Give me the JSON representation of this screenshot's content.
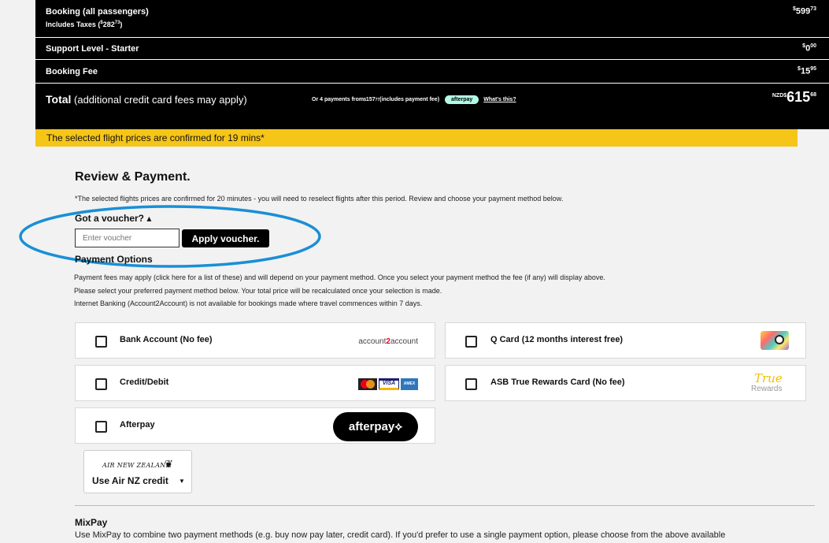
{
  "summary": {
    "booking_label": "Booking (all passengers)",
    "booking_taxes_prefix": "Includes Taxes (",
    "booking_taxes_currency": "$",
    "booking_taxes_whole": "282",
    "booking_taxes_cents": "73",
    "booking_taxes_suffix": ")",
    "booking_price_currency": "$",
    "booking_price_whole": "599",
    "booking_price_cents": "73",
    "support_label": "Support Level - Starter",
    "support_price_currency": "$",
    "support_price_whole": "0",
    "support_price_cents": "00",
    "fee_label": "Booking Fee",
    "fee_price_currency": "$",
    "fee_price_whole": "15",
    "fee_price_cents": "95",
    "total_bold": "Total",
    "total_note": " (additional credit card fees may apply)",
    "installments_prefix": "Or 4 payments from ",
    "installments_currency": "$",
    "installments_whole": "157",
    "installments_cents": "77",
    "installments_suffix": " (includes payment fee)",
    "afterpay_pill": "afterpay",
    "whats_this": "What's this?",
    "total_currency": "NZD$",
    "total_whole": "615",
    "total_cents": "68"
  },
  "banner": {
    "text": "The selected flight prices are confirmed for 19 mins*"
  },
  "review": {
    "title": "Review & Payment.",
    "note": "*The selected flights prices are confirmed for 20 minutes - you will need to reselect flights after this period. Review and choose your payment method below.",
    "voucher_toggle": "Got a voucher? ▴",
    "voucher_placeholder": "Enter voucher",
    "voucher_button": "Apply voucher.",
    "payment_options_title": "Payment Options",
    "payinfo_1": "Payment fees may apply (click here for a list of these) and will depend on your payment method. Once you select your payment method the fee (if any) will display above.",
    "payinfo_2": "Please select your preferred payment method below. Your total price will be recalculated once your selection is made.",
    "payinfo_3": "Internet Banking (Account2Account) is not available for bookings made where travel commences within 7 days."
  },
  "payment_methods": {
    "bank": "Bank Account (No fee)",
    "bank_logo_a": "account",
    "bank_logo_b": "2",
    "bank_logo_c": "account",
    "qcard": "Q Card (12 months interest free)",
    "credit": "Credit/Debit",
    "visa": "VISA",
    "amex": "AMEX",
    "asb": "ASB True Rewards Card (No fee)",
    "true_logo": "True",
    "rewards_logo": "Rewards",
    "afterpay": "Afterpay",
    "afterpay_logo": "afterpay⟡"
  },
  "airnz": {
    "brand": "AIR NEW ZEALAND",
    "use_credit": "Use Air NZ credit",
    "chevron": "▼"
  },
  "mixpay": {
    "title": "MixPay",
    "text": "Use MixPay to combine two payment methods (e.g. buy now pay later, credit card). If you'd prefer to use a single payment option, please choose from the above available"
  },
  "colors": {
    "banner": "#f5c518",
    "afterpay_mint": "#b2fce4",
    "annotation": "#1a8fd6"
  }
}
